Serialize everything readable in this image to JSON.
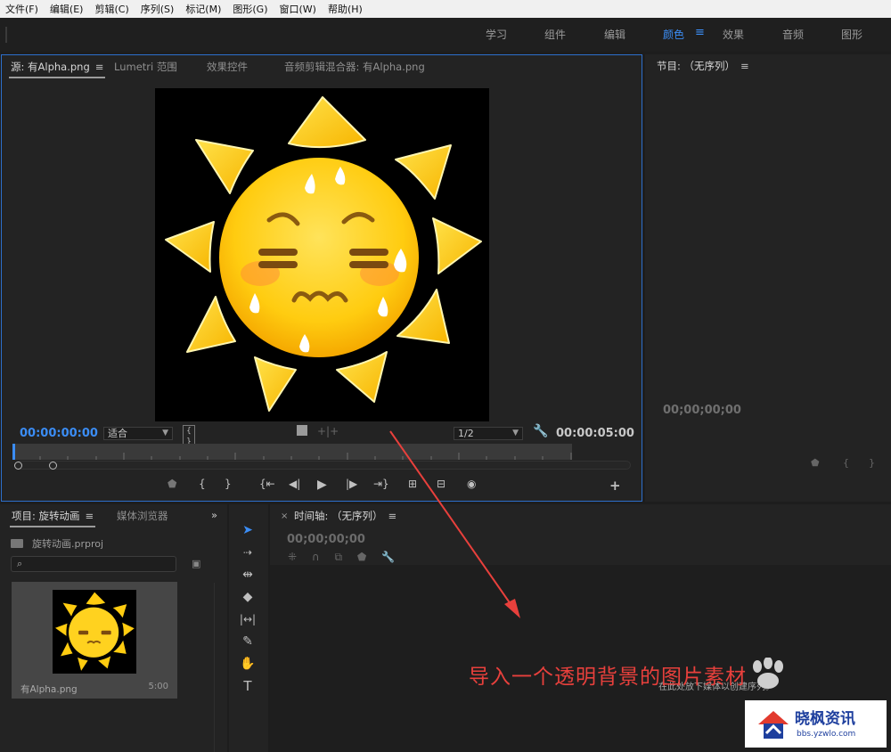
{
  "menubar": {
    "items": [
      "文件(F)",
      "编辑(E)",
      "剪辑(C)",
      "序列(S)",
      "标记(M)",
      "图形(G)",
      "窗口(W)",
      "帮助(H)"
    ]
  },
  "workspaces": {
    "tabs": [
      "学习",
      "组件",
      "编辑",
      "颜色",
      "效果",
      "音频",
      "图形"
    ],
    "active": "颜色",
    "menu_icon": "≡"
  },
  "source_panel": {
    "tabs": [
      "源: 有Alpha.png",
      "Lumetri 范围",
      "效果控件",
      "音频剪辑混合器: 有Alpha.png"
    ],
    "menu_icon": "≡",
    "timecode_in": "00:00:00:00",
    "timecode_duration": "00:00:05:00",
    "zoom_value": "适合",
    "resolution_value": "1/2",
    "image_subject": "sweating-sun-emoji"
  },
  "program_panel": {
    "title": "节目: （无序列）",
    "menu_icon": "≡",
    "timecode": "00;00;00;00"
  },
  "project_panel": {
    "tabs": [
      "项目: 旋转动画",
      "媒体浏览器"
    ],
    "menu_icon": "≡",
    "expand_icon": "»",
    "bin_name": "旋转动画.prproj",
    "clip": {
      "name": "有Alpha.png",
      "duration": "5:00"
    }
  },
  "timeline_panel": {
    "close_label": "×",
    "title": "时间轴: （无序列）",
    "menu_icon": "≡",
    "timecode": "00;00;00;00",
    "drop_hint": "在此处放下媒体以创建序列。",
    "annotation": "导入一个透明背景的图片素材"
  },
  "watermark": {
    "title": "晓枫资讯",
    "url": "bbs.yzwlo.com"
  },
  "colors": {
    "accent": "#3b8df5",
    "annotation": "#e8403c",
    "panel_bg": "#232323",
    "app_bg": "#1d1d1d"
  }
}
